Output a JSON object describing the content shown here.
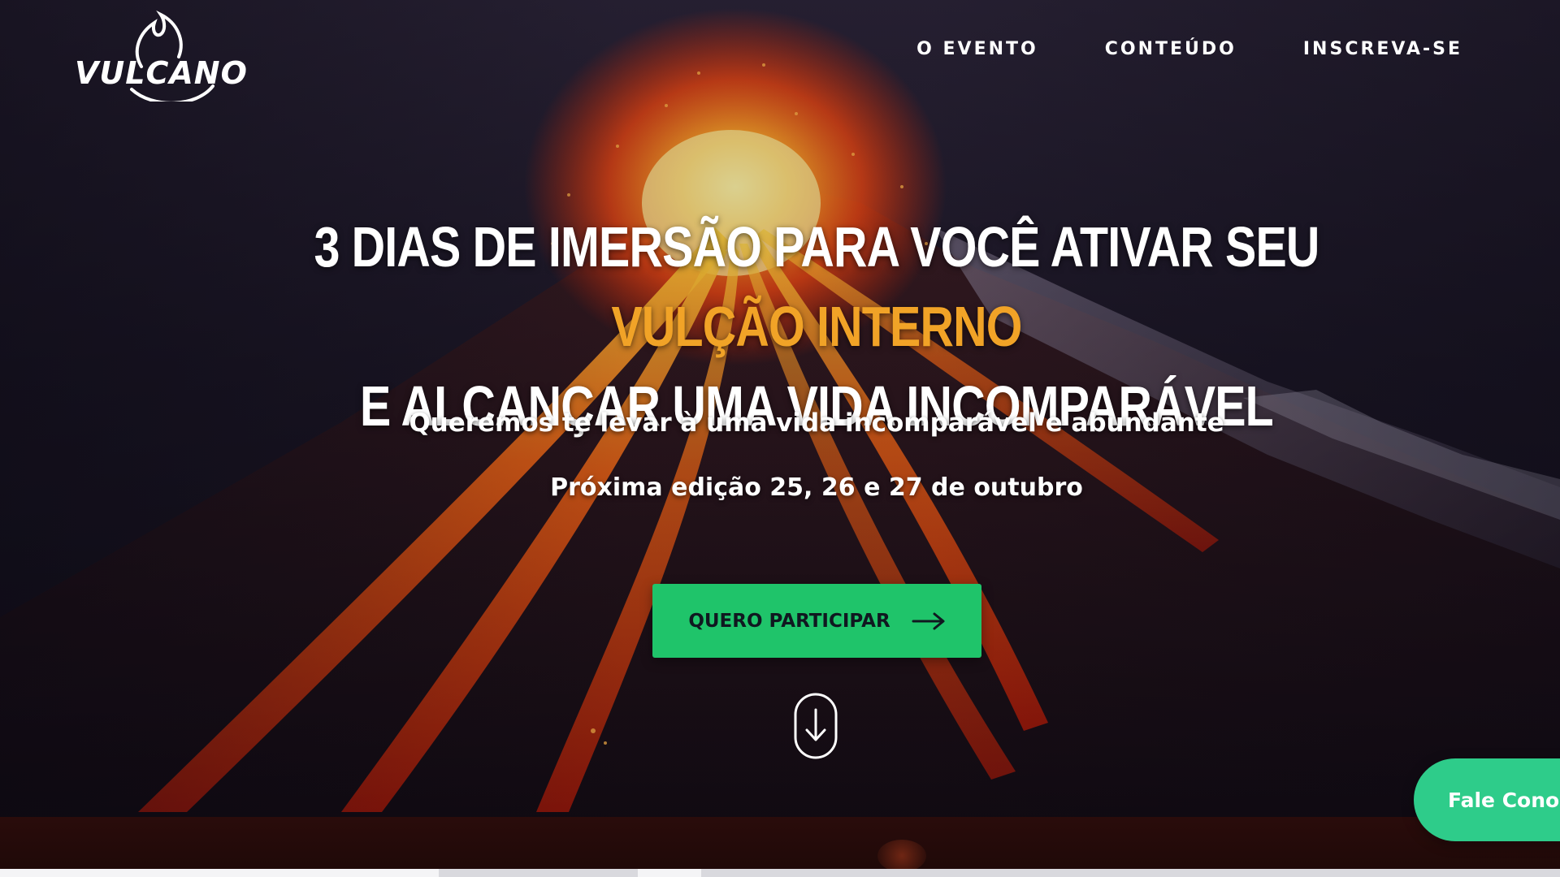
{
  "brand": {
    "logo_text": "VULCANO",
    "logo_icon": "flame-icon"
  },
  "nav": {
    "items": [
      {
        "label": "O EVENTO"
      },
      {
        "label": "CONTEÚDO"
      },
      {
        "label": "INSCREVA-SE"
      }
    ]
  },
  "hero": {
    "headline_part1": "3 DIAS DE IMERSÃO PARA VOCÊ ATIVAR SEU ",
    "headline_accent": "VULÇÃO INTERNO",
    "headline_part2": "E ALCANÇAR UMA VIDA INCOMPARÁVEL",
    "subtitle": "Queremos te levar à uma vida incomparável e abundante",
    "next_edition": "Próxima edição  25, 26 e 27 de outubro",
    "cta_label": "QUERO PARTICIPAR",
    "cta_icon": "arrow-right-icon",
    "scroll_icon": "scroll-down-icon"
  },
  "chat": {
    "label": "Fale Conosco"
  },
  "colors": {
    "accent": "#f1a327",
    "cta": "#1fc46a",
    "chat": "#2ecc8a",
    "lava": "#ff5a1a"
  }
}
